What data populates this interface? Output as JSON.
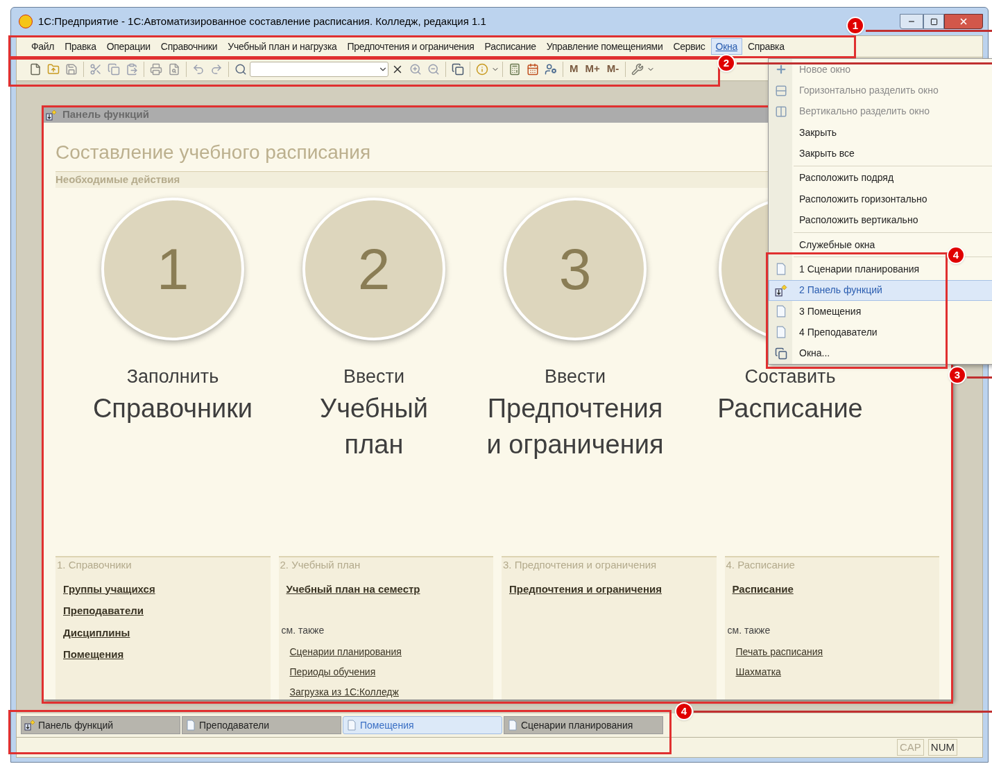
{
  "window": {
    "title": "1С:Предприятие - 1С:Автоматизированное составление расписания. Колледж, редакция 1.1"
  },
  "menu": [
    {
      "label": "Файл",
      "open": false
    },
    {
      "label": "Правка",
      "open": false
    },
    {
      "label": "Операции",
      "open": false
    },
    {
      "label": "Справочники",
      "open": false
    },
    {
      "label": "Учебный план и нагрузка",
      "open": false
    },
    {
      "label": "Предпочтения и ограничения",
      "open": false
    },
    {
      "label": "Расписание",
      "open": false
    },
    {
      "label": "Управление помещениями",
      "open": false
    },
    {
      "label": "Сервис",
      "open": false
    },
    {
      "label": "Окна",
      "open": true
    },
    {
      "label": "Справка",
      "open": false
    }
  ],
  "toolbar": {
    "memory_buttons": [
      "M",
      "M+",
      "M-"
    ]
  },
  "windows_menu": [
    {
      "kind": "new",
      "label": "Новое окно",
      "disabled": true,
      "selected": false
    },
    {
      "kind": "hsplit",
      "label": "Горизонтально разделить окно",
      "disabled": true,
      "selected": false
    },
    {
      "kind": "vsplit",
      "label": "Вертикально разделить окно",
      "disabled": true,
      "selected": false
    },
    {
      "kind": "item",
      "label": "Закрыть",
      "disabled": false,
      "selected": false
    },
    {
      "kind": "item",
      "label": "Закрыть все",
      "disabled": false,
      "selected": false
    },
    {
      "kind": "separator"
    },
    {
      "kind": "item",
      "label": "Расположить подряд",
      "disabled": false,
      "selected": false
    },
    {
      "kind": "item",
      "label": "Расположить горизонтально",
      "disabled": false,
      "selected": false
    },
    {
      "kind": "item",
      "label": "Расположить вертикально",
      "disabled": false,
      "selected": false
    },
    {
      "kind": "separator"
    },
    {
      "kind": "item",
      "label": "Служебные окна",
      "disabled": false,
      "selected": false
    },
    {
      "kind": "separator"
    },
    {
      "kind": "document",
      "label": "1 Сценарии планирования",
      "disabled": false,
      "selected": false
    },
    {
      "kind": "panel",
      "label": "2 Панель функций",
      "disabled": false,
      "selected": true
    },
    {
      "kind": "document",
      "label": "3 Помещения",
      "disabled": false,
      "selected": false
    },
    {
      "kind": "document",
      "label": "4 Преподаватели",
      "disabled": false,
      "selected": false
    },
    {
      "kind": "windows",
      "label": "Окна...",
      "disabled": false,
      "selected": false
    }
  ],
  "function_panel": {
    "title": "Панель функций",
    "heading": "Составление учебного расписания",
    "subheading": "Необходимые действия",
    "steps": [
      {
        "number": "1",
        "verb": "Заполнить",
        "object_lines": [
          "Справочники"
        ]
      },
      {
        "number": "2",
        "verb": "Ввести",
        "object_lines": [
          "Учебный",
          "план"
        ]
      },
      {
        "number": "3",
        "verb": "Ввести",
        "object_lines": [
          "Предпочтения",
          "и ограничения"
        ]
      },
      {
        "verb": "Составить",
        "object_lines": [
          "Расписание"
        ]
      }
    ],
    "sections": [
      {
        "title": "1. Справочники",
        "links": [
          "Группы учащихся",
          "Преподаватели",
          "Дисциплины",
          "Помещения"
        ]
      },
      {
        "title": "2. Учебный план",
        "links": [
          "Учебный план на семестр"
        ],
        "see_also_label": "см. также",
        "see_also": [
          "Сценарии планирования",
          "Периоды обучения",
          "Загрузка из 1С:Колледж"
        ]
      },
      {
        "title": "3. Предпочтения и ограничения",
        "links": [
          "Предпочтения и ограничения"
        ]
      },
      {
        "title": "4. Расписание",
        "links": [
          "Расписание"
        ],
        "see_also_label": "см. также",
        "see_also": [
          "Печать расписания",
          "Шахматка"
        ]
      }
    ]
  },
  "window_tabs": [
    {
      "label": "Панель функций",
      "kind": "panel",
      "selected": false
    },
    {
      "label": "Преподаватели",
      "kind": "document",
      "selected": false
    },
    {
      "label": "Помещения",
      "kind": "document",
      "selected": true
    },
    {
      "label": "Сценарии планирования",
      "kind": "document",
      "selected": false
    }
  ],
  "status_bar": [
    {
      "label": "CAP",
      "active": false
    },
    {
      "label": "NUM",
      "active": true
    }
  ],
  "annotations": [
    "1",
    "2",
    "3",
    "4",
    "4"
  ]
}
